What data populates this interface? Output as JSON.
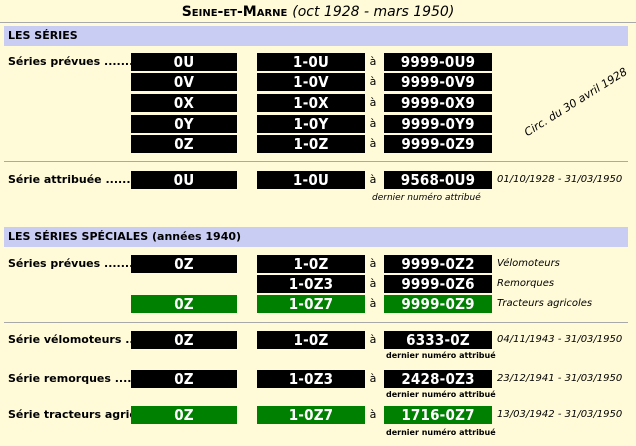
{
  "title": {
    "dept": "Seine-et-Marne",
    "dates": "(oct 1928 - mars 1950)"
  },
  "section1": {
    "header": "LES SÉRIES",
    "planned_label": "Séries prévues .........",
    "planned": [
      {
        "series": "0U",
        "from": "1-0U",
        "sep": "à",
        "to": "9999-0U9"
      },
      {
        "series": "0V",
        "from": "1-0V",
        "sep": "à",
        "to": "9999-0V9"
      },
      {
        "series": "0X",
        "from": "1-0X",
        "sep": "à",
        "to": "9999-0X9"
      },
      {
        "series": "0Y",
        "from": "1-0Y",
        "sep": "à",
        "to": "9999-0Y9"
      },
      {
        "series": "0Z",
        "from": "1-0Z",
        "sep": "à",
        "to": "9999-0Z9"
      }
    ],
    "circular_note": "Circ. du 30 avril 1928",
    "assigned_label": "Série attribuée ........",
    "assigned": {
      "series": "0U",
      "from": "1-0U",
      "sep": "à",
      "to": "9568-0U9",
      "period": "01/10/1928 - 31/03/1950",
      "last_note": "dernier numéro attribué"
    }
  },
  "section2": {
    "header": "LES SÉRIES SPÉCIALES (années 1940)",
    "planned_label": "Séries prévues .........",
    "planned": [
      {
        "series": "0Z",
        "from": "1-0Z",
        "sep": "à",
        "to": "9999-0Z2",
        "note": "Vélomoteurs",
        "green": false
      },
      {
        "series": "",
        "from": "1-0Z3",
        "sep": "à",
        "to": "9999-0Z6",
        "note": "Remorques",
        "green": false
      },
      {
        "series": "0Z",
        "from": "1-0Z7",
        "sep": "à",
        "to": "9999-0Z9",
        "note": "Tracteurs agricoles",
        "green": true
      }
    ],
    "assigned": [
      {
        "label": "Série vélomoteurs ....",
        "series": "0Z",
        "from": "1-0Z",
        "sep": "à",
        "to": "6333-0Z",
        "period": "04/11/1943 - 31/03/1950",
        "last_note": "dernier numéro attribué",
        "green": false
      },
      {
        "label": "Série remorques .......",
        "series": "0Z",
        "from": "1-0Z3",
        "sep": "à",
        "to": "2428-0Z3",
        "period": "23/12/1941 - 31/03/1950",
        "last_note": "dernier numéro attribué",
        "green": false
      },
      {
        "label": "Série tracteurs agric.",
        "series": "0Z",
        "from": "1-0Z7",
        "sep": "à",
        "to": "1716-0Z7",
        "period": "13/03/1942 - 31/03/1950",
        "last_note": "dernier numéro attribué",
        "green": true
      }
    ]
  },
  "colors": {
    "background": "#fffbd9",
    "section_bar": "#c9cdf4",
    "plate": "#000000",
    "plate_green": "#008000"
  }
}
